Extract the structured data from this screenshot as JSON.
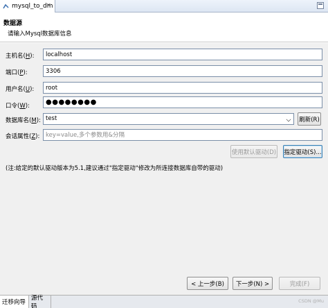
{
  "tab": {
    "title": "mysql_to_dm",
    "icon": "database-icon"
  },
  "header": {
    "title": "数据源",
    "description": "请输入Mysql数据库信息"
  },
  "form": {
    "host": {
      "label": "主机名",
      "mnemonic": "H",
      "value": "localhost"
    },
    "port": {
      "label": "端口",
      "mnemonic": "P",
      "value": "3306"
    },
    "user": {
      "label": "用户名",
      "mnemonic": "U",
      "value": "root"
    },
    "password": {
      "label": "口令",
      "mnemonic": "W",
      "value": "●●●●●●●●"
    },
    "database": {
      "label": "数据库名",
      "mnemonic": "M",
      "value": "test"
    },
    "session": {
      "label": "会话属性",
      "mnemonic": "Z",
      "placeholder": "key=value,多个参数用&分隔"
    }
  },
  "buttons": {
    "refresh": "刷新(R)",
    "use_default_driver": "使用默认驱动(D)",
    "specify_driver": "指定驱动(S)...",
    "prev": "< 上一步(B)",
    "next": "下一步(N) >",
    "finish": "完成(F)"
  },
  "note": "(注:给定的默认驱动版本为5.1,建议通过\"指定驱动\"修改为所连接数据库自带的驱动)",
  "bottom_tabs": [
    "迁移向导",
    "源代码"
  ],
  "watermark": "CSDN @Mu"
}
